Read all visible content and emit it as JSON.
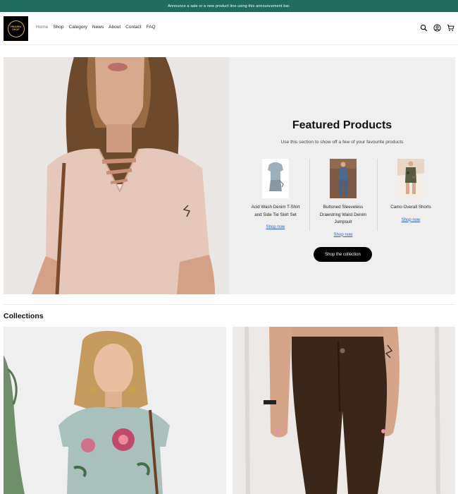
{
  "announcement": {
    "text": "Announce a sale or a new product line using this announcement bar."
  },
  "brand": {
    "logo_text": "HEAVEN SHOP"
  },
  "nav": {
    "items": [
      {
        "label": "Home",
        "active": true
      },
      {
        "label": "Shop"
      },
      {
        "label": "Category"
      },
      {
        "label": "News"
      },
      {
        "label": "About"
      },
      {
        "label": "Contact"
      },
      {
        "label": "FAQ"
      }
    ]
  },
  "header_icons": [
    "search-icon",
    "account-icon",
    "cart-icon"
  ],
  "featured": {
    "title": "Featured Products",
    "subtitle": "Use this section to show off a few of your favourite products",
    "products": [
      {
        "name_line1": "Acid Wash Denim T-Shirt",
        "name_line2": "and Side Tie Skirt Set",
        "name_line3": "",
        "link": "Shop now"
      },
      {
        "name_line1": "Buttoned Sleeveless",
        "name_line2": "Drawstring Waist Denim",
        "name_line3": "Jumpsuit",
        "link": "Shop now"
      },
      {
        "name_line1": "Camo Overall Shorts",
        "name_line2": "",
        "name_line3": "",
        "link": "Shop now"
      }
    ],
    "button": "Shop the collection"
  },
  "collections": {
    "title": "Collections"
  },
  "colors": {
    "announcement_bg": "#1f6b5c",
    "link": "#2a5fd4",
    "button_bg": "#000000",
    "panel_bg": "#efefef"
  }
}
